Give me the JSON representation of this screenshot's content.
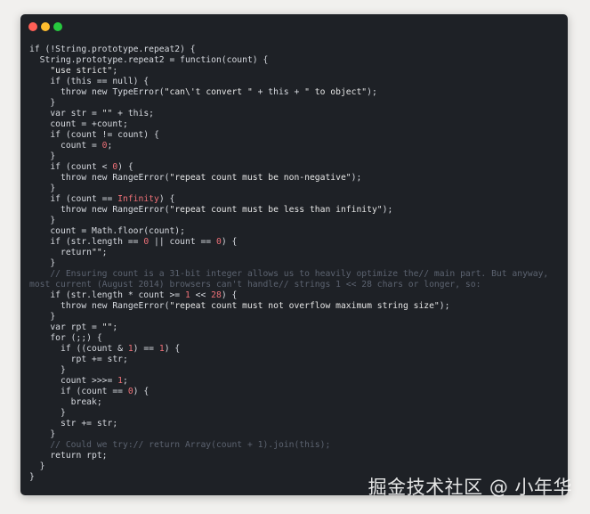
{
  "code_window": {
    "lines": [
      "if (!String.prototype.repeat2) {",
      "  String.prototype.repeat2 = function(count) {",
      "    \"use strict\";",
      "    if (this == null) {",
      "      throw new TypeError(\"can\\'t convert \" + this + \" to object\");",
      "    }",
      "    var str = \"\" + this;",
      "    count = +count;",
      "    if (count != count) {",
      "      count = 0;",
      "    }",
      "    if (count < 0) {",
      "      throw new RangeError(\"repeat count must be non-negative\");",
      "    }",
      "    if (count == Infinity) {",
      "      throw new RangeError(\"repeat count must be less than infinity\");",
      "    }",
      "    count = Math.floor(count);",
      "    if (str.length == 0 || count == 0) {",
      "      return\"\";",
      "    }",
      "    // Ensuring count is a 31-bit integer allows us to heavily optimize the// main part. But anyway,",
      "most current (August 2014) browsers can't handle// strings 1 << 28 chars or longer, so:",
      "    if (str.length * count >= 1 << 28) {",
      "      throw new RangeError(\"repeat count must not overflow maximum string size\");",
      "    }",
      "    var rpt = \"\";",
      "    for (;;) {",
      "      if ((count & 1) == 1) {",
      "        rpt += str;",
      "      }",
      "      count >>>= 1;",
      "      if (count == 0) {",
      "        break;",
      "      }",
      "      str += str;",
      "    }",
      "    // Could we try:// return Array(count + 1).join(this);",
      "    return rpt;",
      "  }",
      "}"
    ]
  },
  "watermark": "掘金技术社区 @ 小年华",
  "colors": {
    "background": "#f1f0ee",
    "window": "#1e2126",
    "text": "#d7dae0",
    "number": "#f07178",
    "comment": "#5c6370",
    "close": "#ff5f56",
    "minimize": "#ffbd2e",
    "maximize": "#27c93f"
  }
}
